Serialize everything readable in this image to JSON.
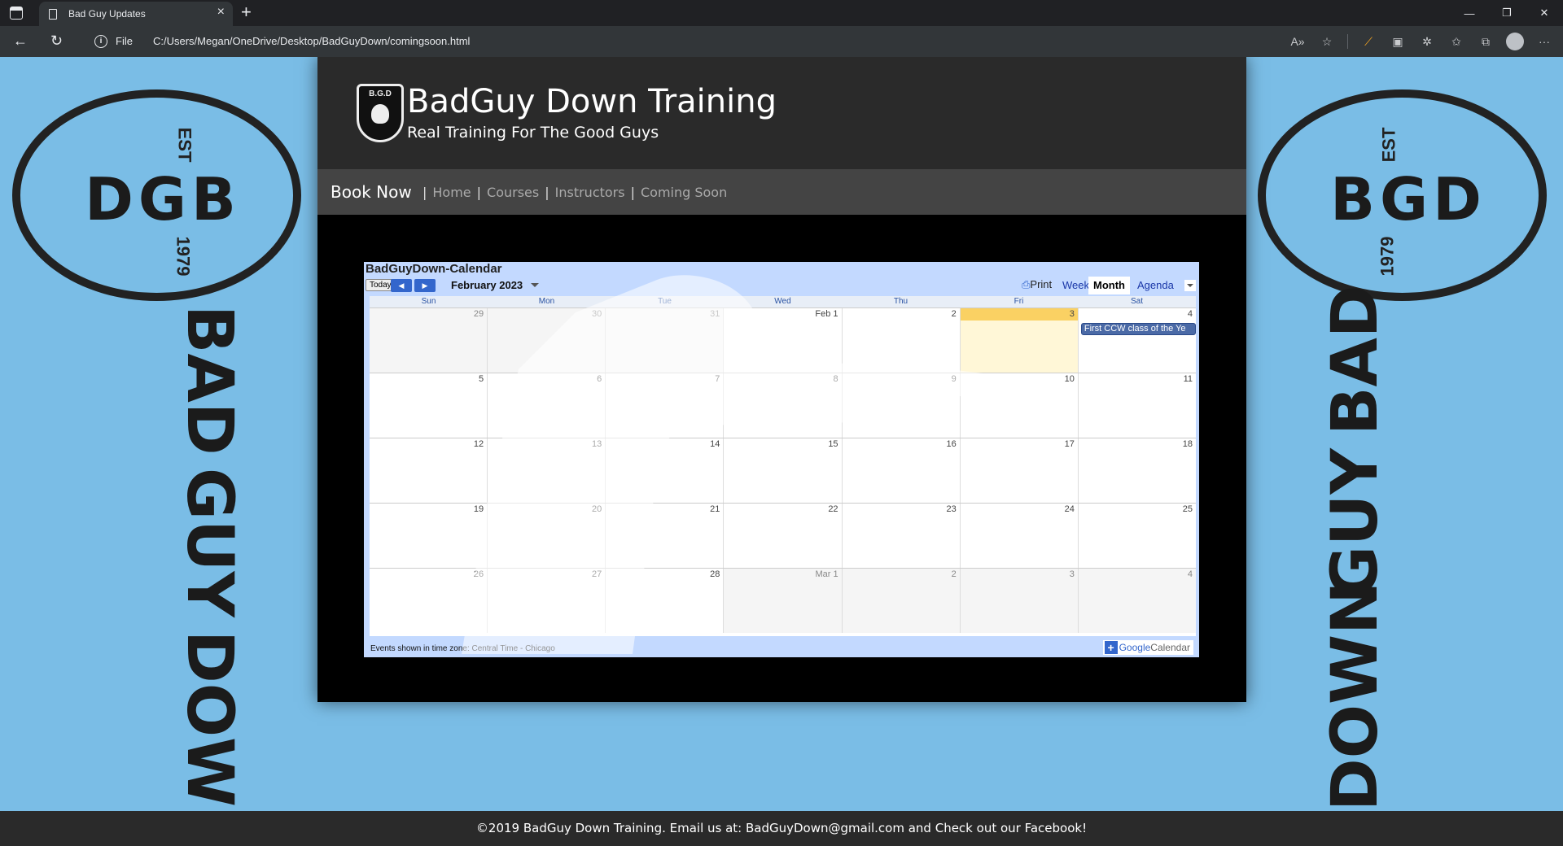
{
  "browser": {
    "tab_title": "Bad Guy Updates",
    "file_label": "File",
    "url": "C:/Users/Megan/OneDrive/Desktop/BadGuyDown/comingsoon.html"
  },
  "site": {
    "title": "BadGuy Down Training",
    "tagline": "Real Training For The Good Guys",
    "logo_text": "B.G.D"
  },
  "side_logo": {
    "dgb": "DGB",
    "bgd": "BGD",
    "est": "EST",
    "year": "1979",
    "words": [
      "BAD",
      "GUY",
      "DOWN"
    ]
  },
  "nav": {
    "book_now": "Book Now",
    "links": [
      "Home",
      "Courses",
      "Instructors",
      "Coming Soon"
    ]
  },
  "calendar": {
    "title": "BadGuyDown-Calendar",
    "today_label": "Today",
    "month_label": "February 2023",
    "print_label": "Print",
    "views": [
      "Week",
      "Month",
      "Agenda"
    ],
    "days_of_week": [
      "Sun",
      "Mon",
      "Tue",
      "Wed",
      "Thu",
      "Fri",
      "Sat"
    ],
    "weeks": [
      [
        "29",
        "30",
        "31",
        "Feb 1",
        "2",
        "3",
        "4"
      ],
      [
        "5",
        "6",
        "7",
        "8",
        "9",
        "10",
        "11"
      ],
      [
        "12",
        "13",
        "14",
        "15",
        "16",
        "17",
        "18"
      ],
      [
        "19",
        "20",
        "21",
        "22",
        "23",
        "24",
        "25"
      ],
      [
        "26",
        "27",
        "28",
        "Mar 1",
        "2",
        "3",
        "4"
      ]
    ],
    "event_text": "First CCW class of the Ye",
    "timezone_text": "Events shown in time zone: Central Time - Chicago",
    "gcal_text_google": "Google",
    "gcal_text_calendar": "Calendar"
  },
  "footer": {
    "text": "©2019 BadGuy Down Training. Email us at: BadGuyDown@gmail.com and Check out our Facebook!"
  }
}
